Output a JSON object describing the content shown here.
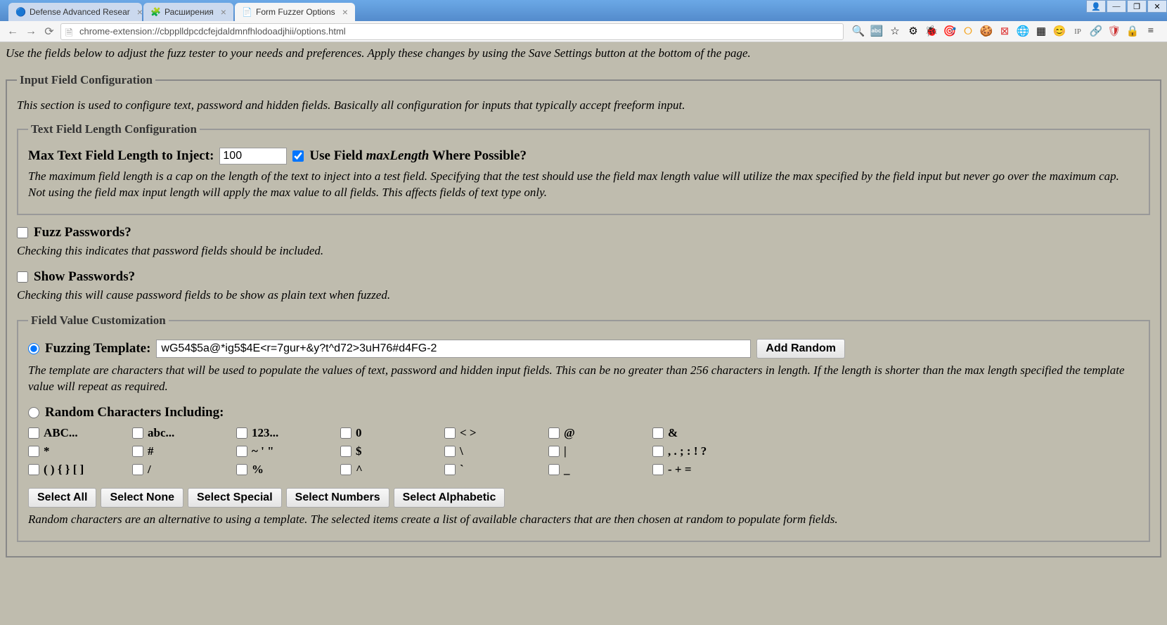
{
  "window": {
    "controls": {
      "user": "👤",
      "min": "—",
      "max": "❐",
      "close": "✕"
    }
  },
  "browser": {
    "tabs": [
      {
        "title": "Defense Advanced Resear"
      },
      {
        "title": "Расширения"
      },
      {
        "title": "Form Fuzzer Options"
      }
    ],
    "url": "chrome-extension://cbpplldpcdcfejdaldmnfhlodoadjhii/options.html"
  },
  "page": {
    "intro": "Use the fields below to adjust the fuzz tester to your needs and preferences. Apply these changes by using the Save Settings button at the bottom of the page.",
    "input_config": {
      "legend": "Input Field Configuration",
      "intro": "This section is used to configure text, password and hidden fields. Basically all configuration for inputs that typically accept freeform input.",
      "text_len": {
        "legend": "Text Field Length Configuration",
        "max_label": "Max Text Field Length to Inject:",
        "max_value": "100",
        "use_maxlen_label_prefix": "Use Field ",
        "use_maxlen_label_em": "maxLength",
        "use_maxlen_label_suffix": " Where Possible?",
        "help": "The maximum field length is a cap on the length of the text to inject into a test field. Specifying that the test should use the field max length value will utilize the max specified by the field input but never go over the maximum cap. Not using the field max input length will apply the max value to all fields. This affects fields of text type only."
      },
      "fuzz_pw": {
        "label": "Fuzz Passwords?",
        "help": "Checking this indicates that password fields should be included."
      },
      "show_pw": {
        "label": "Show Passwords?",
        "help": "Checking this will cause password fields to be show as plain text when fuzzed."
      },
      "field_value": {
        "legend": "Field Value Customization",
        "template_label": "Fuzzing Template:",
        "template_value": "wG54$5a@*ig5$4E<r=7gur+&y?t^d72>3uH76#d4FG-2",
        "add_random_btn": "Add Random",
        "template_help": "The template are characters that will be used to populate the values of text, password and hidden input fields. This can be no greater than 256 characters in length. If the length is shorter than the max length specified the template value will repeat as required.",
        "random_label": "Random Characters Including:",
        "char_items": [
          "ABC...",
          "abc...",
          "123...",
          "0",
          "< >",
          "@",
          "&",
          "*",
          "#",
          "~ ' \"",
          "$",
          "\\",
          "|",
          ", . ; : ! ?",
          "( ) { } [ ]",
          "/",
          "%",
          "^",
          "`",
          "_",
          "- + ="
        ],
        "buttons": {
          "select_all": "Select All",
          "select_none": "Select None",
          "select_special": "Select Special",
          "select_numbers": "Select Numbers",
          "select_alpha": "Select Alphabetic"
        },
        "random_help": "Random characters are an alternative to using a template. The selected items create a list of available characters that are then chosen at random to populate form fields."
      }
    }
  }
}
